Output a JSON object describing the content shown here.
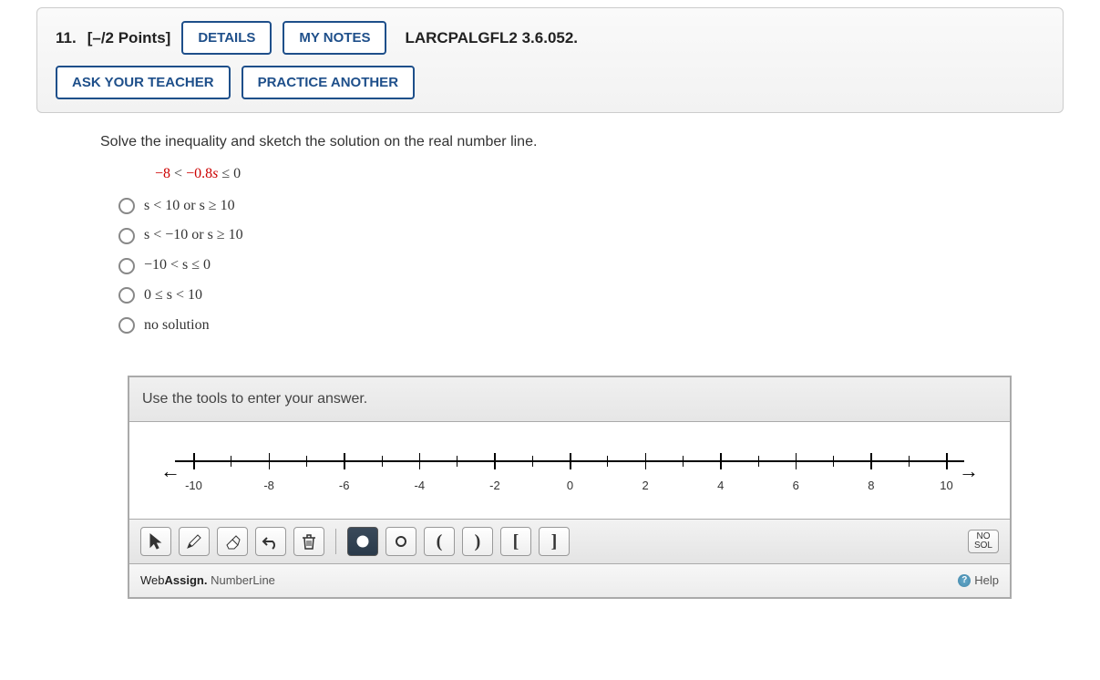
{
  "header": {
    "question_num": "11.",
    "points": "[–/2 Points]",
    "details": "DETAILS",
    "my_notes": "MY NOTES",
    "book_ref": "LARCPALGFL2 3.6.052.",
    "ask_teacher": "ASK YOUR TEACHER",
    "practice": "PRACTICE ANOTHER"
  },
  "prompt": "Solve the inequality and sketch the solution on the real number line.",
  "inequality": {
    "lhs": "−8",
    "op1": " < ",
    "mid_coeff": "−0.8",
    "mid_var": "s",
    "op2": " ≤ ",
    "rhs": "0"
  },
  "options": [
    "s < 10 or s ≥ 10",
    "s < −10 or s ≥ 10",
    "−10 < s ≤ 0",
    "0 ≤ s < 10",
    "no solution"
  ],
  "numberline": {
    "header": "Use the tools to enter your answer.",
    "ticks": [
      {
        "v": -10,
        "major": true,
        "label": "-10"
      },
      {
        "v": -9,
        "major": false
      },
      {
        "v": -8,
        "major": true,
        "label": "-8"
      },
      {
        "v": -7,
        "major": false
      },
      {
        "v": -6,
        "major": true,
        "label": "-6"
      },
      {
        "v": -5,
        "major": false
      },
      {
        "v": -4,
        "major": true,
        "label": "-4"
      },
      {
        "v": -3,
        "major": false
      },
      {
        "v": -2,
        "major": true,
        "label": "-2"
      },
      {
        "v": -1,
        "major": false
      },
      {
        "v": 0,
        "major": true,
        "label": "0"
      },
      {
        "v": 1,
        "major": false
      },
      {
        "v": 2,
        "major": true,
        "label": "2"
      },
      {
        "v": 3,
        "major": false
      },
      {
        "v": 4,
        "major": true,
        "label": "4"
      },
      {
        "v": 5,
        "major": false
      },
      {
        "v": 6,
        "major": true,
        "label": "6"
      },
      {
        "v": 7,
        "major": false
      },
      {
        "v": 8,
        "major": true,
        "label": "8"
      },
      {
        "v": 9,
        "major": false
      },
      {
        "v": 10,
        "major": true,
        "label": "10"
      }
    ],
    "tools": {
      "pointer": "pointer",
      "draw": "draw",
      "erase": "erase",
      "undo": "undo",
      "delete": "delete",
      "closed_point": "closed-point",
      "open_point": "open-point",
      "open_paren_l": "(",
      "open_paren_r": ")",
      "closed_bracket_l": "[",
      "closed_bracket_r": "]",
      "no_sol_line1": "NO",
      "no_sol_line2": "SOL"
    },
    "brand": {
      "web": "Web",
      "assign": "Assign.",
      "suffix": "NumberLine"
    },
    "help": "Help"
  }
}
